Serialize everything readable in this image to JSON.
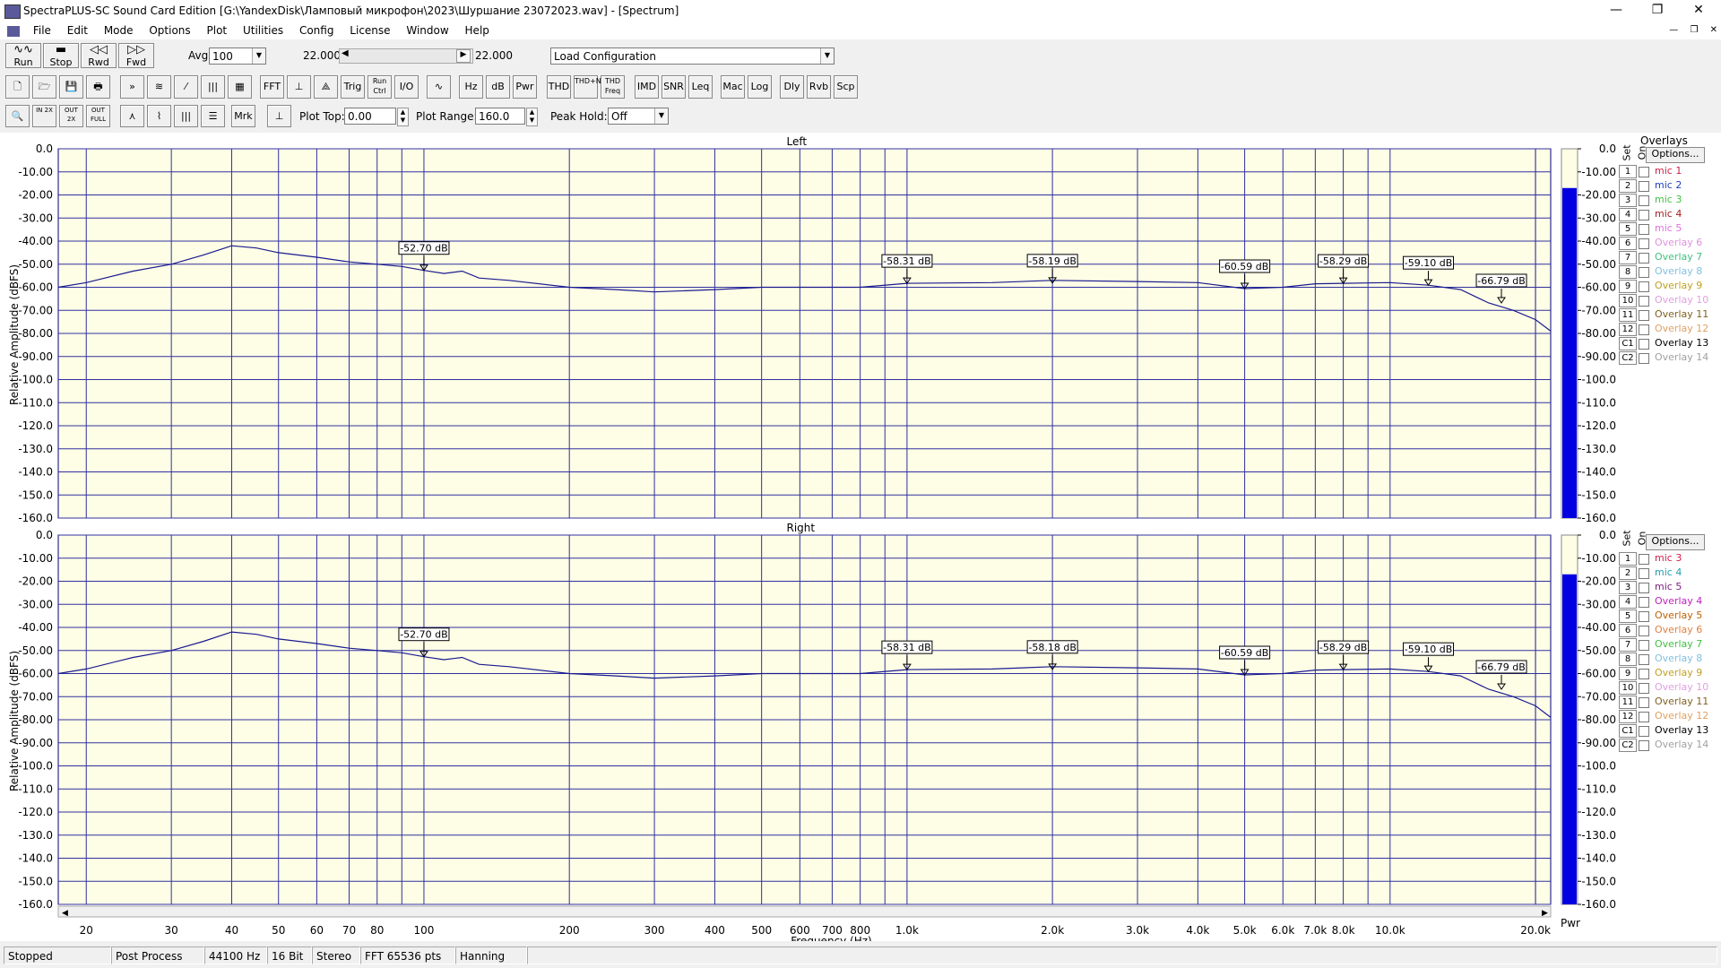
{
  "window": {
    "title": "SpectraPLUS-SC Sound Card Edition [G:\\YandexDisk\\Ламповый микрофон\\2023\\Шуршание 23072023.wav] - [Spectrum]",
    "min": "—",
    "max": "❐",
    "close": "✕"
  },
  "menu": [
    "File",
    "Edit",
    "Mode",
    "Options",
    "Plot",
    "Utilities",
    "Config",
    "License",
    "Window",
    "Help"
  ],
  "transport": [
    {
      "name": "run-button",
      "icon": "∿∿",
      "label": "Run"
    },
    {
      "name": "stop-button",
      "icon": "▬",
      "label": "Stop"
    },
    {
      "name": "rewind-button",
      "icon": "◁◁",
      "label": "Rwd"
    },
    {
      "name": "forward-button",
      "icon": "▷▷",
      "label": "Fwd"
    }
  ],
  "avg": {
    "label": "Avg",
    "value": "100"
  },
  "time_left": "22.000",
  "time_right": "22.000",
  "config_select": "Load Configuration",
  "toolbar2": [
    {
      "t": "🗋",
      "n": "new-file"
    },
    {
      "t": "🗁",
      "n": "open-file"
    },
    {
      "t": "💾",
      "n": "save-file"
    },
    {
      "t": "🖶",
      "n": "print"
    },
    {
      "t": "»",
      "n": "mode-1"
    },
    {
      "t": "≋",
      "n": "mode-2"
    },
    {
      "t": "⁄",
      "n": "mode-3"
    },
    {
      "t": "|||",
      "n": "mode-4"
    },
    {
      "t": "▦",
      "n": "mode-5"
    },
    {
      "t": "FFT",
      "n": "fft"
    },
    {
      "t": "⊥",
      "n": "axis"
    },
    {
      "t": "⟁",
      "n": "wave"
    },
    {
      "t": "Trig",
      "n": "trig"
    },
    {
      "t": "Run Ctrl",
      "n": "run-ctrl"
    },
    {
      "t": "I/O",
      "n": "io"
    },
    {
      "t": "∿",
      "n": "generator"
    },
    {
      "t": "Hz",
      "n": "hz"
    },
    {
      "t": "dB",
      "n": "db"
    },
    {
      "t": "Pwr",
      "n": "pwr"
    },
    {
      "t": "THD",
      "n": "thd"
    },
    {
      "t": "THD+N",
      "n": "thd-n"
    },
    {
      "t": "THD Freq",
      "n": "thd-freq"
    },
    {
      "t": "IMD",
      "n": "imd"
    },
    {
      "t": "SNR",
      "n": "snr"
    },
    {
      "t": "Leq",
      "n": "leq"
    },
    {
      "t": "Mac",
      "n": "mac"
    },
    {
      "t": "Log",
      "n": "log"
    },
    {
      "t": "Dly",
      "n": "dly"
    },
    {
      "t": "Rvb",
      "n": "rvb"
    },
    {
      "t": "Scp",
      "n": "scp"
    }
  ],
  "toolbar3": [
    {
      "t": "🔍",
      "n": "zoom"
    },
    {
      "t": "IN 2X",
      "n": "zoom-in-2x"
    },
    {
      "t": "OUT 2X",
      "n": "zoom-out-2x"
    },
    {
      "t": "OUT FULL",
      "n": "zoom-out-full"
    },
    {
      "t": "⋏",
      "n": "view-1"
    },
    {
      "t": "⌇",
      "n": "view-2"
    },
    {
      "t": "|||",
      "n": "view-3"
    },
    {
      "t": "☰",
      "n": "view-4"
    },
    {
      "t": "Mrk",
      "n": "marker"
    },
    {
      "t": "⊥",
      "n": "cursor"
    }
  ],
  "plot_top": {
    "label": "Plot Top:",
    "value": "0.00"
  },
  "plot_range": {
    "label": "Plot Range:",
    "value": "160.0"
  },
  "peak_hold": {
    "label": "Peak Hold:",
    "value": "Off"
  },
  "overlays_label": "Overlays",
  "options_label": "Options...",
  "set_label": "Set",
  "on_label": "On",
  "pwr_label": "Pwr",
  "overlays_left": [
    {
      "num": "1",
      "name": "mic 1",
      "color": "#d0204a"
    },
    {
      "num": "2",
      "name": "mic 2",
      "color": "#2040c0"
    },
    {
      "num": "3",
      "name": "mic 3",
      "color": "#40c040"
    },
    {
      "num": "4",
      "name": "mic 4",
      "color": "#a02020"
    },
    {
      "num": "5",
      "name": "mic 5",
      "color": "#e070e0"
    },
    {
      "num": "6",
      "name": "Overlay 6",
      "color": "#e090e0"
    },
    {
      "num": "7",
      "name": "Overlay 7",
      "color": "#40c080"
    },
    {
      "num": "8",
      "name": "Overlay 8",
      "color": "#80c0e0"
    },
    {
      "num": "9",
      "name": "Overlay 9",
      "color": "#c0a020"
    },
    {
      "num": "10",
      "name": "Overlay 10",
      "color": "#e0a0e0"
    },
    {
      "num": "11",
      "name": "Overlay 11",
      "color": "#806020"
    },
    {
      "num": "12",
      "name": "Overlay 12",
      "color": "#e0a060"
    },
    {
      "num": "C1",
      "name": "Overlay 13",
      "color": "#000000"
    },
    {
      "num": "C2",
      "name": "Overlay 14",
      "color": "#a0a0a0"
    }
  ],
  "overlays_right": [
    {
      "num": "1",
      "name": "mic 3",
      "color": "#d0204a"
    },
    {
      "num": "2",
      "name": "mic 4",
      "color": "#20a0b0"
    },
    {
      "num": "3",
      "name": "mic 5",
      "color": "#802080"
    },
    {
      "num": "4",
      "name": "Overlay 4",
      "color": "#c020c0"
    },
    {
      "num": "5",
      "name": "Overlay 5",
      "color": "#c06000"
    },
    {
      "num": "6",
      "name": "Overlay 6",
      "color": "#e08040"
    },
    {
      "num": "7",
      "name": "Overlay 7",
      "color": "#40c040"
    },
    {
      "num": "8",
      "name": "Overlay 8",
      "color": "#80c0e0"
    },
    {
      "num": "9",
      "name": "Overlay 9",
      "color": "#c0a020"
    },
    {
      "num": "10",
      "name": "Overlay 10",
      "color": "#e0a0e0"
    },
    {
      "num": "11",
      "name": "Overlay 11",
      "color": "#806020"
    },
    {
      "num": "12",
      "name": "Overlay 12",
      "color": "#e0a060"
    },
    {
      "num": "C1",
      "name": "Overlay 13",
      "color": "#000000"
    },
    {
      "num": "C2",
      "name": "Overlay 14",
      "color": "#a0a0a0"
    }
  ],
  "status": [
    "Stopped",
    "Post Process",
    "44100 Hz",
    "16 Bit",
    "Stereo",
    "FFT 65536 pts",
    "Hanning"
  ],
  "chart_data": [
    {
      "type": "line",
      "title": "Left",
      "ylabel": "Relative Amplitude (dBFS)",
      "xlabel": "Frequency (Hz)",
      "xscale": "log",
      "xlim": [
        17.5,
        21500
      ],
      "ylim": [
        -160,
        0
      ],
      "yticks": [
        0,
        -10,
        -20,
        -30,
        -40,
        -50,
        -60,
        -70,
        -80,
        -90,
        -100,
        -110,
        -120,
        -130,
        -140,
        -150,
        -160
      ],
      "ytick_labels": [
        "0.0",
        "-10.00",
        "-20.00",
        "-30.00",
        "-40.00",
        "-50.00",
        "-60.00",
        "-70.00",
        "-80.00",
        "-90.00",
        "-100.0",
        "-110.0",
        "-120.0",
        "-130.0",
        "-140.0",
        "-150.0",
        "-160.0"
      ],
      "grid": true,
      "series": [
        {
          "x": [
            17.5,
            20,
            25,
            30,
            35,
            40,
            45,
            50,
            60,
            70,
            80,
            90,
            100,
            110,
            120,
            130,
            150,
            200,
            250,
            300,
            400,
            500,
            600,
            800,
            1000,
            1500,
            2000,
            3000,
            4000,
            5000,
            6000,
            7000,
            8000,
            10000,
            12000,
            14000,
            16000,
            18000,
            20000,
            21500
          ],
          "y": [
            -60,
            -58,
            -53,
            -50,
            -46,
            -42,
            -43,
            -45,
            -47,
            -49,
            -50,
            -51,
            -52.7,
            -54,
            -53,
            -56,
            -57,
            -60,
            -61,
            -62,
            -61,
            -60,
            -60,
            -60,
            -58.3,
            -58,
            -57,
            -57.5,
            -58,
            -60.6,
            -60,
            -58.5,
            -58.3,
            -58,
            -59.1,
            -61,
            -66.8,
            -70,
            -74,
            -79
          ]
        }
      ],
      "markers": [
        {
          "x": 100,
          "y": -52.7,
          "label": "-52.70 dB"
        },
        {
          "x": 1000,
          "y": -58.31,
          "label": "-58.31 dB"
        },
        {
          "x": 2000,
          "y": -58.19,
          "label": "-58.19 dB"
        },
        {
          "x": 5000,
          "y": -60.59,
          "label": "-60.59 dB"
        },
        {
          "x": 8000,
          "y": -58.29,
          "label": "-58.29 dB"
        },
        {
          "x": 12000,
          "y": -59.1,
          "label": "-59.10 dB"
        },
        {
          "x": 17000,
          "y": -66.79,
          "label": "-66.79 dB"
        }
      ],
      "power_level": -17
    },
    {
      "type": "line",
      "title": "Right",
      "ylabel": "Relative Amplitude (dBFS)",
      "xlabel": "Frequency (Hz)",
      "xscale": "log",
      "xlim": [
        17.5,
        21500
      ],
      "ylim": [
        -160,
        0
      ],
      "xticks": [
        20,
        30,
        40,
        50,
        60,
        70,
        80,
        100,
        200,
        300,
        400,
        500,
        600,
        700,
        800,
        1000,
        2000,
        3000,
        4000,
        5000,
        6000,
        7000,
        8000,
        10000,
        20000
      ],
      "xtick_labels": [
        "20",
        "30",
        "40",
        "50",
        "60",
        "70",
        "80",
        "100",
        "200",
        "300",
        "400",
        "500",
        "600",
        "700",
        "800",
        "1.0k",
        "2.0k",
        "3.0k",
        "4.0k",
        "5.0k",
        "6.0k",
        "7.0k",
        "8.0k",
        "10.0k",
        "20.0k"
      ],
      "yticks": [
        0,
        -10,
        -20,
        -30,
        -40,
        -50,
        -60,
        -70,
        -80,
        -90,
        -100,
        -110,
        -120,
        -130,
        -140,
        -150,
        -160
      ],
      "ytick_labels": [
        "0.0",
        "-10.00",
        "-20.00",
        "-30.00",
        "-40.00",
        "-50.00",
        "-60.00",
        "-70.00",
        "-80.00",
        "-90.00",
        "-100.0",
        "-110.0",
        "-120.0",
        "-130.0",
        "-140.0",
        "-150.0",
        "-160.0"
      ],
      "grid": true,
      "series": [
        {
          "x": [
            17.5,
            20,
            25,
            30,
            35,
            40,
            45,
            50,
            60,
            70,
            80,
            90,
            100,
            110,
            120,
            130,
            150,
            200,
            250,
            300,
            400,
            500,
            600,
            800,
            1000,
            1500,
            2000,
            3000,
            4000,
            5000,
            6000,
            7000,
            8000,
            10000,
            12000,
            14000,
            16000,
            18000,
            20000,
            21500
          ],
          "y": [
            -60,
            -58,
            -53,
            -50,
            -46,
            -42,
            -43,
            -45,
            -47,
            -49,
            -50,
            -51,
            -52.7,
            -54,
            -53,
            -56,
            -57,
            -60,
            -61,
            -62,
            -61,
            -60,
            -60,
            -60,
            -58.3,
            -58,
            -57,
            -57.5,
            -58,
            -60.6,
            -60,
            -58.5,
            -58.3,
            -58,
            -59.1,
            -61,
            -66.8,
            -70,
            -74,
            -79
          ]
        }
      ],
      "markers": [
        {
          "x": 100,
          "y": -52.7,
          "label": "-52.70 dB"
        },
        {
          "x": 1000,
          "y": -58.31,
          "label": "-58.31 dB"
        },
        {
          "x": 2000,
          "y": -58.18,
          "label": "-58.18 dB"
        },
        {
          "x": 5000,
          "y": -60.59,
          "label": "-60.59 dB"
        },
        {
          "x": 8000,
          "y": -58.29,
          "label": "-58.29 dB"
        },
        {
          "x": 12000,
          "y": -59.1,
          "label": "-59.10 dB"
        },
        {
          "x": 17000,
          "y": -66.79,
          "label": "-66.79 dB"
        }
      ],
      "power_level": -17
    }
  ]
}
